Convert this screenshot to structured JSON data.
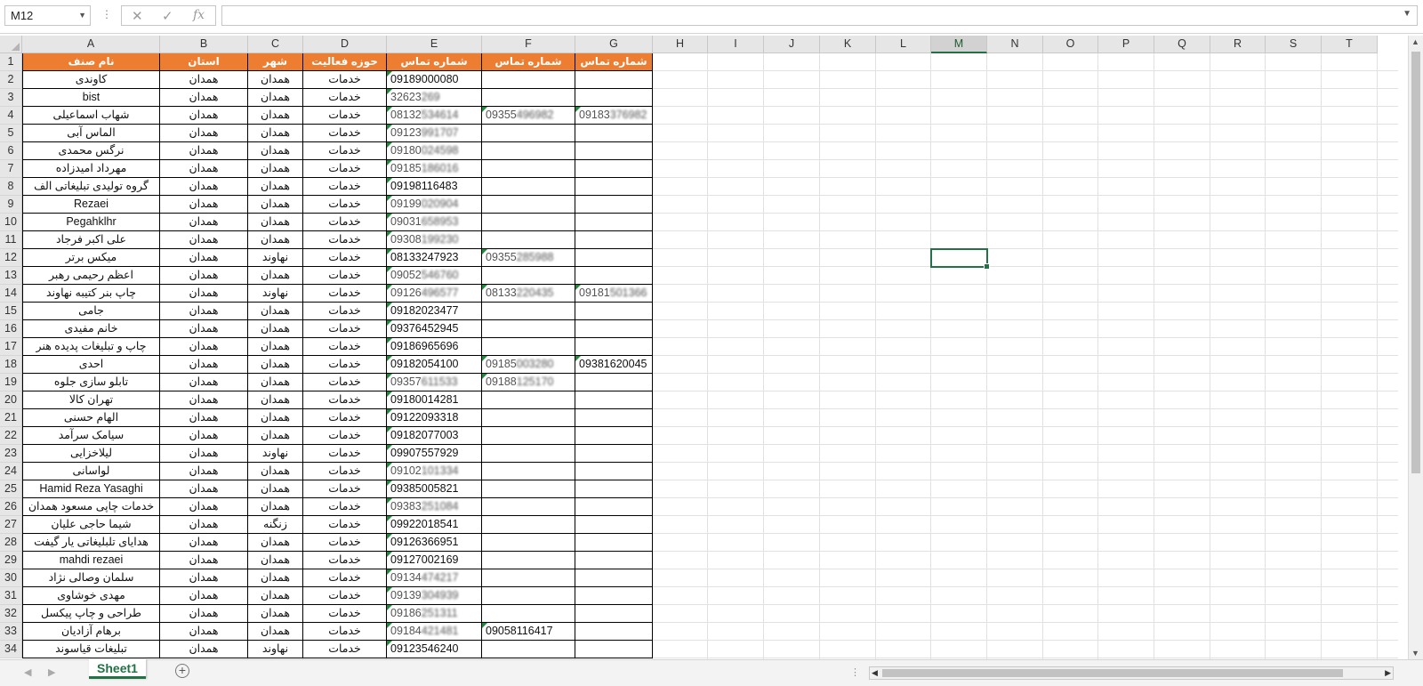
{
  "formula_bar": {
    "name_box": "M12",
    "cancel_icon": "x-icon",
    "enter_icon": "check-icon",
    "function_icon": "fx-icon",
    "formula": ""
  },
  "columns": [
    "A",
    "B",
    "C",
    "D",
    "E",
    "F",
    "G",
    "H",
    "I",
    "J",
    "K",
    "L",
    "M",
    "N",
    "O",
    "P",
    "Q",
    "R",
    "S",
    "T"
  ],
  "selected_column": "M",
  "selected_cell": "M12",
  "header_fill_color": "#ED7D31",
  "selection_color": "#217346",
  "headers": [
    "نام صنف",
    "استان",
    "شهر",
    "حوزه فعالیت",
    "شماره تماس",
    "شماره تماس",
    "شماره تماس"
  ],
  "rows": [
    [
      "کاوندی",
      "همدان",
      "همدان",
      "خدمات",
      "09189000080",
      "",
      ""
    ],
    [
      "bist",
      "همدان",
      "همدان",
      "خدمات",
      "32623269",
      "",
      ""
    ],
    [
      "شهاب اسماعیلی",
      "همدان",
      "همدان",
      "خدمات",
      "08132534614",
      "09355496982",
      "09183376982"
    ],
    [
      "الماس آبی",
      "همدان",
      "همدان",
      "خدمات",
      "09123991707",
      "",
      ""
    ],
    [
      "نرگس محمدی",
      "همدان",
      "همدان",
      "خدمات",
      "09180024598",
      "",
      ""
    ],
    [
      "مهرداد امیدزاده",
      "همدان",
      "همدان",
      "خدمات",
      "09185186016",
      "",
      ""
    ],
    [
      "گروه تولیدی تبلیغاتی الف",
      "همدان",
      "همدان",
      "خدمات",
      "09198116483",
      "",
      ""
    ],
    [
      "Rezaei",
      "همدان",
      "همدان",
      "خدمات",
      "09199020904",
      "",
      ""
    ],
    [
      "Pegahklhr",
      "همدان",
      "همدان",
      "خدمات",
      "09031658953",
      "",
      ""
    ],
    [
      "علی اکبر فرجاد",
      "همدان",
      "همدان",
      "خدمات",
      "09308199230",
      "",
      ""
    ],
    [
      "میکس برتر",
      "همدان",
      "نهاوند",
      "خدمات",
      "08133247923",
      "09355285988",
      ""
    ],
    [
      "اعظم رحیمی رهبر",
      "همدان",
      "همدان",
      "خدمات",
      "09052546760",
      "",
      ""
    ],
    [
      "چاپ بنر کتیبه نهاوند",
      "همدان",
      "نهاوند",
      "خدمات",
      "09126496577",
      "08133220435",
      "09181501366"
    ],
    [
      "جامی",
      "همدان",
      "همدان",
      "خدمات",
      "09182023477",
      "",
      ""
    ],
    [
      "خانم مفیدی",
      "همدان",
      "همدان",
      "خدمات",
      "09376452945",
      "",
      ""
    ],
    [
      "چاپ و تبلیغات پدیده هنر",
      "همدان",
      "همدان",
      "خدمات",
      "09186965696",
      "",
      ""
    ],
    [
      "احدی",
      "همدان",
      "همدان",
      "خدمات",
      "09182054100",
      "09185003280",
      "09381620045"
    ],
    [
      "تابلو سازی جلوه",
      "همدان",
      "همدان",
      "خدمات",
      "09357611533",
      "09188125170",
      ""
    ],
    [
      "تهران کالا",
      "همدان",
      "همدان",
      "خدمات",
      "09180014281",
      "",
      ""
    ],
    [
      "الهام حسنی",
      "همدان",
      "همدان",
      "خدمات",
      "09122093318",
      "",
      ""
    ],
    [
      "سیامک سرآمد",
      "همدان",
      "همدان",
      "خدمات",
      "09182077003",
      "",
      ""
    ],
    [
      "لیلاخزایی",
      "همدان",
      "نهاوند",
      "خدمات",
      "09907557929",
      "",
      ""
    ],
    [
      "لواسانی",
      "همدان",
      "همدان",
      "خدمات",
      "09102101334",
      "",
      ""
    ],
    [
      "Hamid Reza Yasaghi",
      "همدان",
      "همدان",
      "خدمات",
      "09385005821",
      "",
      ""
    ],
    [
      "خدمات چاپی مسعود همدان",
      "همدان",
      "همدان",
      "خدمات",
      "09383251084",
      "",
      ""
    ],
    [
      "شیما حاجی علیان",
      "همدان",
      "زنگنه",
      "خدمات",
      "09922018541",
      "",
      ""
    ],
    [
      "هدایای تلبلیغاتی یار گیفت",
      "همدان",
      "همدان",
      "خدمات",
      "09126366951",
      "",
      ""
    ],
    [
      "mahdi rezaei",
      "همدان",
      "همدان",
      "خدمات",
      "09127002169",
      "",
      ""
    ],
    [
      "سلمان وصالی نژاد",
      "همدان",
      "همدان",
      "خدمات",
      "09134474217",
      "",
      ""
    ],
    [
      "مهدی خوشاوی",
      "همدان",
      "همدان",
      "خدمات",
      "09139304939",
      "",
      ""
    ],
    [
      "طراحی و چاپ پیکسل",
      "همدان",
      "همدان",
      "خدمات",
      "09186251311",
      "",
      ""
    ],
    [
      "برهام  آزادیان",
      "همدان",
      "همدان",
      "خدمات",
      "09184421481",
      "09058116417",
      ""
    ],
    [
      "تبلیغات قیاسوند",
      "همدان",
      "نهاوند",
      "خدمات",
      "09123546240",
      "",
      ""
    ]
  ],
  "sheet_tab": "Sheet1",
  "add_sheet_icon": "plus-circle-icon"
}
